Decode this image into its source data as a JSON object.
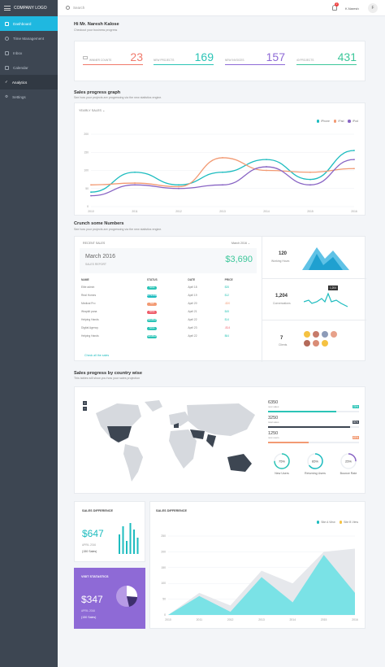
{
  "app": {
    "logo": "COMPANY LOGO"
  },
  "sidebar": {
    "items": [
      {
        "label": "Dashboard",
        "icon": "home-icon"
      },
      {
        "label": "Time Management",
        "icon": "clock-icon"
      },
      {
        "label": "Inbox",
        "icon": "mail-icon"
      },
      {
        "label": "Calendar",
        "icon": "calendar-icon"
      },
      {
        "label": "Analytics",
        "icon": "chart-icon"
      },
      {
        "label": "Settings",
        "icon": "gear-icon"
      }
    ]
  },
  "topbar": {
    "search_placeholder": "Search",
    "notification_count": "2",
    "user_name": "K.Naresh",
    "avatar_initial": "F"
  },
  "welcome": {
    "title": "Hi Mr. Naresh Kalose",
    "subtitle": "Checkout your business progress"
  },
  "stats": [
    {
      "label": "WINNER COUNTS",
      "value": "23",
      "color": "#f07a6c"
    },
    {
      "label": "NEW PROJECTS",
      "value": "169",
      "color": "#2bc4b6"
    },
    {
      "label": "NEW INVOICES",
      "value": "157",
      "color": "#8e6ad6"
    },
    {
      "label": "40 PROJECTS",
      "value": "431",
      "color": "#3cc79a"
    }
  ],
  "sales_graph": {
    "title": "Sales progress graph",
    "subtitle": "See how your projects are progressing via the new statistics engine.",
    "dropdown": "YEARLY SALES"
  },
  "chart_data": [
    {
      "type": "line",
      "categories": [
        "2010",
        "2011",
        "2012",
        "2013",
        "2014",
        "2015",
        "2016"
      ],
      "ylim": [
        0,
        200
      ],
      "yticks": [
        0,
        50,
        100,
        150,
        200
      ],
      "series": [
        {
          "name": "iPhone",
          "color": "#1dbcbf",
          "values": [
            40,
            95,
            60,
            95,
            130,
            75,
            155
          ]
        },
        {
          "name": "iPad",
          "color": "#f29a73",
          "values": [
            60,
            65,
            55,
            135,
            100,
            95,
            105
          ]
        },
        {
          "name": "iPod",
          "color": "#8864c4",
          "values": [
            30,
            60,
            50,
            60,
            110,
            60,
            130
          ]
        }
      ]
    },
    {
      "type": "area",
      "title": "SALES DIFFERENCE",
      "categories": [
        "2010",
        "2011",
        "2012",
        "2013",
        "2014",
        "2015",
        "2016"
      ],
      "ylim": [
        0,
        250
      ],
      "yticks": [
        0,
        50,
        100,
        150,
        200,
        250
      ],
      "series": [
        {
          "name": "Site A View",
          "color": "#74e1e6",
          "values": [
            0,
            60,
            10,
            120,
            40,
            190,
            70
          ]
        },
        {
          "name": "Site B View",
          "color": "#e3e5ea",
          "values": [
            0,
            70,
            30,
            140,
            100,
            200,
            210
          ]
        }
      ]
    }
  ],
  "crunch": {
    "title": "Crunch some Numbers",
    "subtitle": "See how your projects are progressing via the new statistics engine.",
    "recent_sales": "RECENT SALES",
    "month_select": "March 2016",
    "month": "March 2016",
    "report": "SALES REPORT",
    "amount": "$3,690",
    "columns": [
      "NAME",
      "STATUS",
      "DATE",
      "PRICE"
    ],
    "rows": [
      {
        "name": "Elite admin",
        "status": "SALE",
        "status_color": "#2bc4b6",
        "date": "April 18",
        "price": "$35",
        "price_color": "#2bc4b6"
      },
      {
        "name": "Real Homes",
        "status": "EXTENDED",
        "status_color": "#1dbcbf",
        "date": "April 19",
        "price": "$12",
        "price_color": "#2bc4b6"
      },
      {
        "name": "Medical Pro",
        "status": "TAX",
        "status_color": "#f29a73",
        "date": "April 20",
        "price": "-$20",
        "price_color": "#f29a73"
      },
      {
        "name": "Wrapkit pana",
        "status": "SALE",
        "status_color": "#ef5d6b",
        "date": "April 21",
        "price": "$45",
        "price_color": "#2bc4b6"
      },
      {
        "name": "Helping Hands",
        "status": "MEMBER",
        "status_color": "#2bc4b6",
        "date": "April 22",
        "price": "$14",
        "price_color": "#2bc4b6"
      },
      {
        "name": "Digital Agency",
        "status": "SALE",
        "status_color": "#2bc4b6",
        "date": "April 23",
        "price": "-$14",
        "price_color": "#ef5d6b"
      },
      {
        "name": "Helping Hands",
        "status": "MEMBER",
        "status_color": "#2bc4b6",
        "date": "April 22",
        "price": "$64",
        "price_color": "#2bc4b6"
      }
    ],
    "check_all": "Check all the sales",
    "working_hours": {
      "value": "120",
      "label": "Working Hours"
    },
    "conversations": {
      "value": "1,204",
      "label": "Conversations",
      "tooltip": "1,204"
    },
    "clients": {
      "value": "7",
      "label": "Clients"
    }
  },
  "country": {
    "title": "Sales progress by country wise",
    "subtitle": "This tables will show you how your sales projection",
    "bars": [
      {
        "value": "6350",
        "label": "new sales",
        "pct": "75%",
        "percent": 75,
        "color": "#2bc4b6"
      },
      {
        "value": "3250",
        "label": "total sales",
        "pct": "90%",
        "percent": 90,
        "color": "#3d4652"
      },
      {
        "value": "1250",
        "label": "new users",
        "pct": "45%",
        "percent": 45,
        "color": "#f29a73"
      }
    ],
    "rings": [
      {
        "value": "75%",
        "label": "New Users",
        "percent": 75,
        "color": "#2bc4b6"
      },
      {
        "value": "65%",
        "label": "Returning Users",
        "percent": 65,
        "color": "#1dbcbf"
      },
      {
        "value": "25%",
        "label": "Bounce Rate",
        "percent": 25,
        "color": "#8864c4"
      }
    ]
  },
  "sales_diff_small": {
    "title": "SALES DIFFERENCE",
    "value": "$647",
    "date": "APRIL 2016",
    "sales": "(150 Sales)",
    "bars": [
      60,
      85,
      40,
      95,
      75,
      50
    ]
  },
  "visit_stats": {
    "title": "VISIT STATASTICS",
    "value": "$347",
    "date": "APRIL 2016",
    "sales": "(150 Sales)"
  },
  "area_chart": {
    "title": "SALES DIFFERENCE"
  }
}
